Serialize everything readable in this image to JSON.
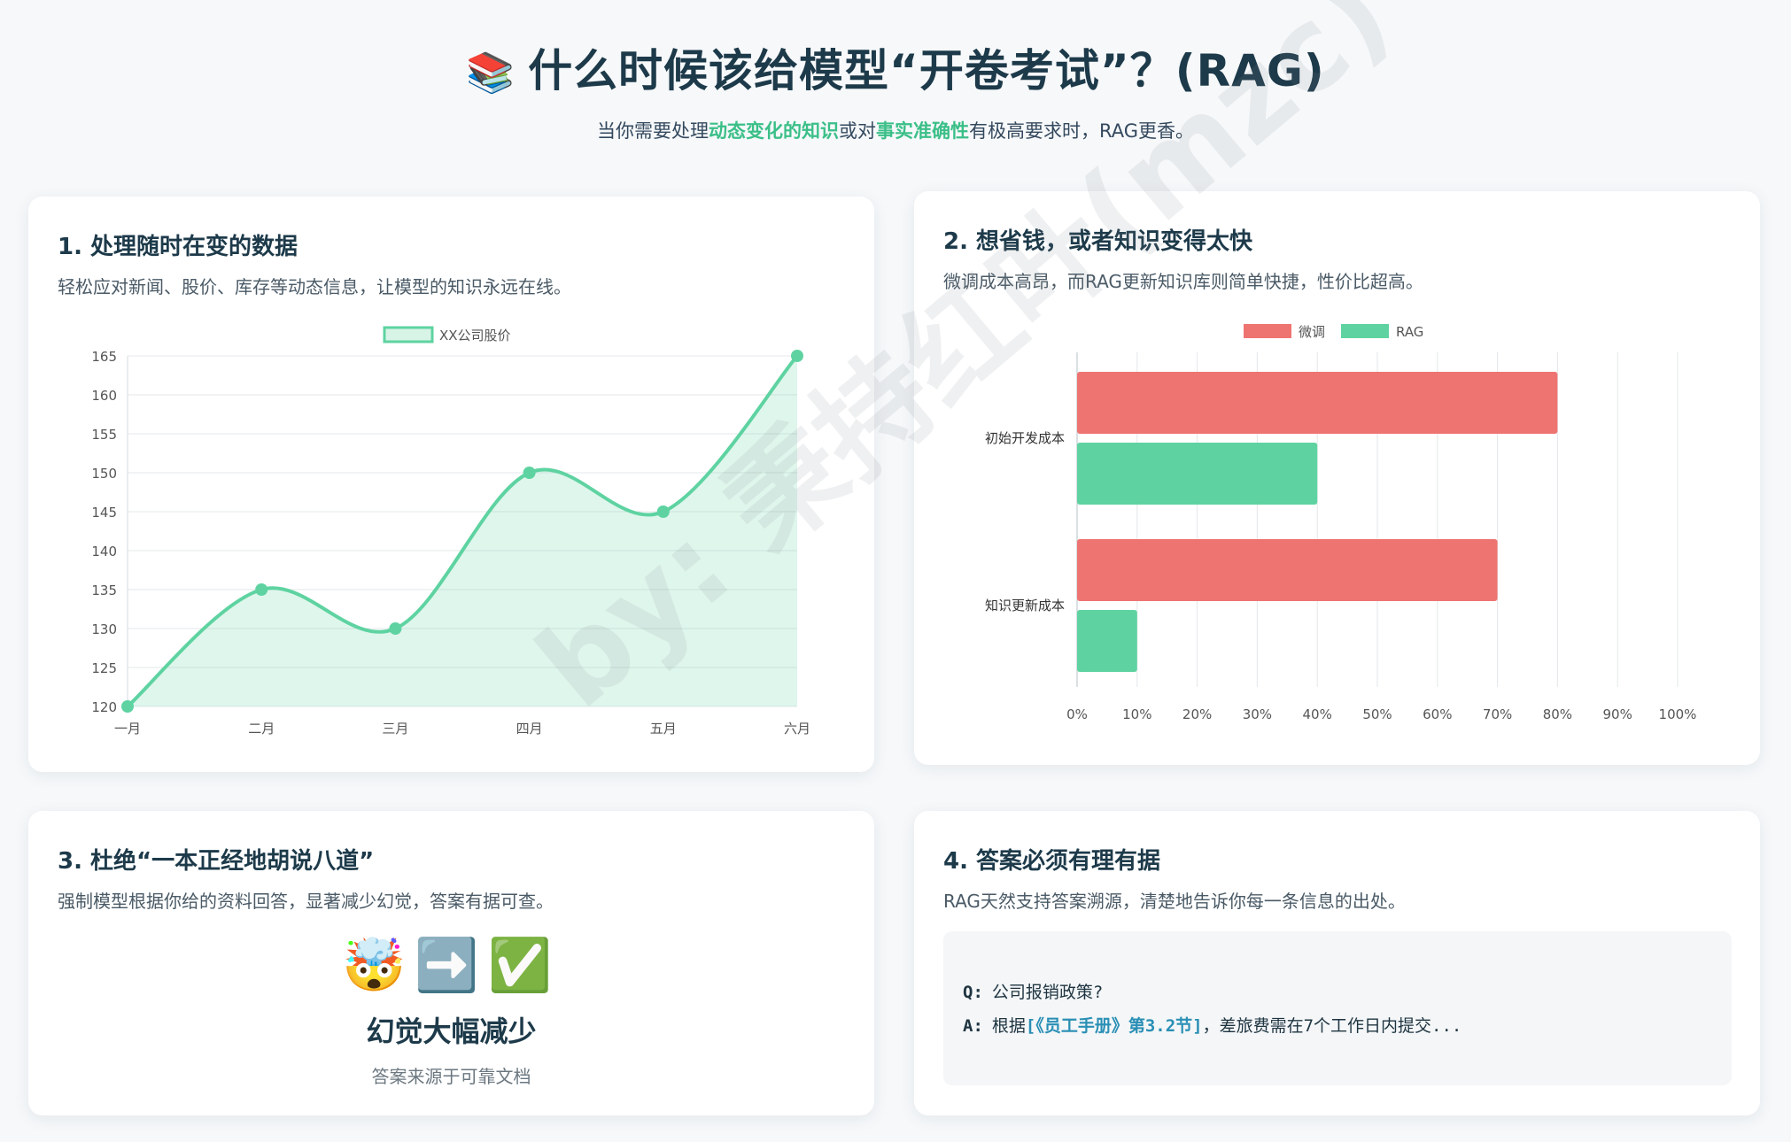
{
  "header": {
    "icon": "books-icon",
    "title": "什么时候该给模型“开卷考试”？(RAG)",
    "subtitle_parts": [
      "当你需要处理",
      "动态变化的知识",
      "或对",
      "事实准确性",
      "有极高要求时，RAG更香。"
    ]
  },
  "colors": {
    "accent_green": "#5ed3a1",
    "accent_red": "#ee7472",
    "title": "#1d3a4a"
  },
  "cards": [
    {
      "title": "1. 处理随时在变的数据",
      "desc": "轻松应对新闻、股价、库存等动态信息，让模型的知识永远在线。"
    },
    {
      "title": "2. 想省钱，或者知识变得太快",
      "desc": "微调成本高昂，而RAG更新知识库则简单快捷，性价比超高。"
    },
    {
      "title": "3. 杜绝“一本正经地胡说八道”",
      "desc": "强制模型根据你给的资料回答，显著减少幻觉，答案有据可查。"
    },
    {
      "title": "4. 答案必须有理有据",
      "desc": "RAG天然支持答案溯源，清楚地告诉你每一条信息的出处。"
    }
  ],
  "card3": {
    "emojis": "🤯➡️✅",
    "big_text": "幻觉大幅减少",
    "small_text": "答案来源于可靠文档"
  },
  "card4": {
    "q_key": "Q:",
    "q_text": "公司报销政策?",
    "a_key": "A:",
    "a_prefix": "根据",
    "a_cite": "[《员工手册》第3.2节]",
    "a_suffix": "，差旅费需在7个工作日内提交..."
  },
  "watermark": "by: 秉持红叶(mzc)",
  "chart_data": [
    {
      "type": "area",
      "categories": [
        "一月",
        "二月",
        "三月",
        "四月",
        "五月",
        "六月"
      ],
      "series": [
        {
          "name": "XX公司股价",
          "values": [
            120,
            135,
            130,
            150,
            145,
            165
          ],
          "color": "#5ed3a1"
        }
      ],
      "ylim": [
        120,
        165
      ],
      "yticks": [
        120,
        125,
        130,
        135,
        140,
        145,
        150,
        155,
        160,
        165
      ],
      "grid": true,
      "legend": "top"
    },
    {
      "type": "bar",
      "orientation": "horizontal",
      "categories": [
        "初始开发成本",
        "知识更新成本"
      ],
      "series": [
        {
          "name": "微调",
          "values": [
            80,
            70
          ],
          "color": "#ee7472"
        },
        {
          "name": "RAG",
          "values": [
            40,
            10
          ],
          "color": "#5ed3a1"
        }
      ],
      "xlim": [
        0,
        100
      ],
      "xticks": [
        "0%",
        "10%",
        "20%",
        "30%",
        "40%",
        "50%",
        "60%",
        "70%",
        "80%",
        "90%",
        "100%"
      ],
      "grid": true,
      "legend": "top"
    }
  ]
}
